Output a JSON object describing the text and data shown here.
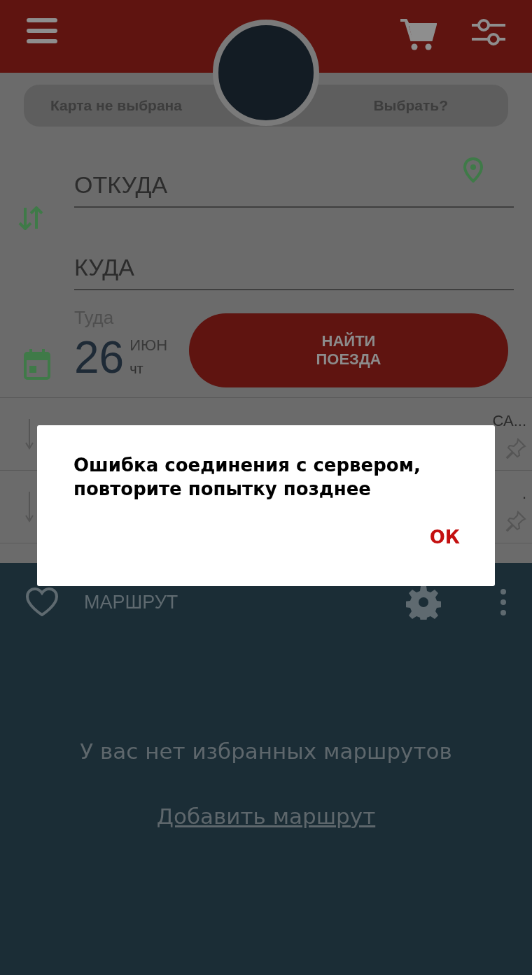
{
  "header": {
    "card_status": "Карта не выбрана",
    "card_action": "Выбрать?"
  },
  "form": {
    "from": {
      "placeholder": "ОТКУДА"
    },
    "to": {
      "placeholder": "КУДА"
    },
    "date": {
      "label": "Туда",
      "day": "26",
      "month": "ИЮН",
      "weekday": "чт"
    },
    "search_button": "НАЙТИ ПОЕЗДА"
  },
  "recent_rows": [
    "СА...",
    "."
  ],
  "favorites": {
    "title": "МАРШРУТ",
    "empty_message": "У вас нет избранных маршрутов",
    "add_link": "Добавить маршрут"
  },
  "dialog": {
    "message": "Ошибка соединения с сервером, повторите попытку позднее",
    "button": "ОК"
  }
}
